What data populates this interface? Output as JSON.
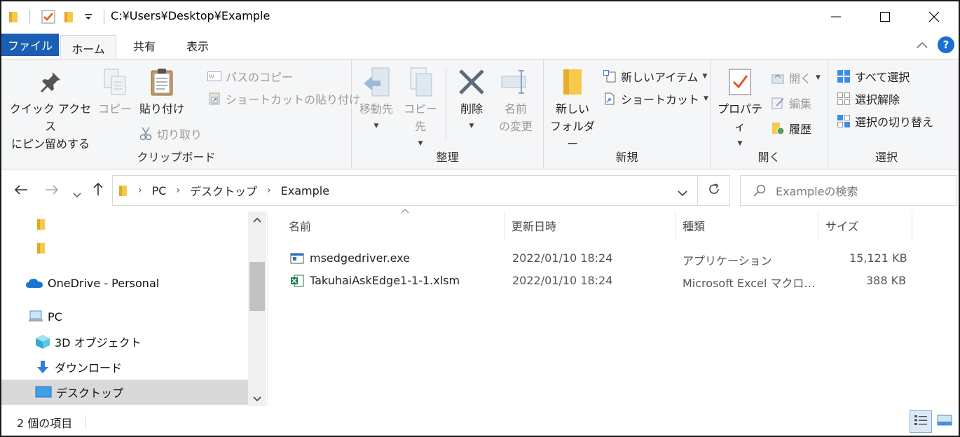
{
  "title_bar": {
    "path": "C:¥Users¥Desktop¥Example",
    "minimize": "—",
    "maximize": "☐",
    "close": "✕"
  },
  "tabs": {
    "file": "ファイル",
    "home": "ホーム",
    "share": "共有",
    "view": "表示",
    "collapse": "^",
    "help": "?"
  },
  "ribbon": {
    "clipboard": {
      "label": "クリップボード",
      "pin_line1": "クイック アクセス",
      "pin_line2": "にピン留めする",
      "copy": "コピー",
      "paste": "貼り付け",
      "copy_path": "パスのコピー",
      "paste_shortcut": "ショートカットの貼り付け",
      "cut": "切り取り"
    },
    "organize": {
      "label": "整理",
      "move_to": "移動先",
      "copy_to": "コピー先",
      "delete": "削除",
      "rename_line1": "名前",
      "rename_line2": "の変更"
    },
    "new": {
      "label": "新規",
      "new_folder_line1": "新しい",
      "new_folder_line2": "フォルダー",
      "new_item": "新しいアイテム",
      "shortcut": "ショートカット"
    },
    "open": {
      "label": "開く",
      "properties": "プロパティ",
      "open": "開く",
      "edit": "編集",
      "history": "履歴"
    },
    "select": {
      "label": "選択",
      "select_all": "すべて選択",
      "select_none": "選択解除",
      "invert": "選択の切り替え"
    }
  },
  "address": {
    "crumbs": [
      "PC",
      "デスクトップ",
      "Example"
    ],
    "search_placeholder": "Exampleの検索"
  },
  "nav_pane": {
    "items": [
      "OneDrive - Personal",
      "PC",
      "3D オブジェクト",
      "ダウンロード",
      "デスクトップ"
    ]
  },
  "columns": {
    "name": "名前",
    "modified": "更新日時",
    "type": "種類",
    "size": "サイズ"
  },
  "files": [
    {
      "name": "msedgedriver.exe",
      "modified": "2022/01/10 18:24",
      "type": "アプリケーション",
      "size": "15,121 KB"
    },
    {
      "name": "TakuhaiAskEdge1-1-1.xlsm",
      "modified": "2022/01/10 18:24",
      "type": "Microsoft Excel マクロ…",
      "size": "388 KB"
    }
  ],
  "status": {
    "item_count": "2 個の項目"
  },
  "colors": {
    "accent": "#1a5fb4",
    "folder": "#f6c94a",
    "selection": "#d9d9d9"
  }
}
